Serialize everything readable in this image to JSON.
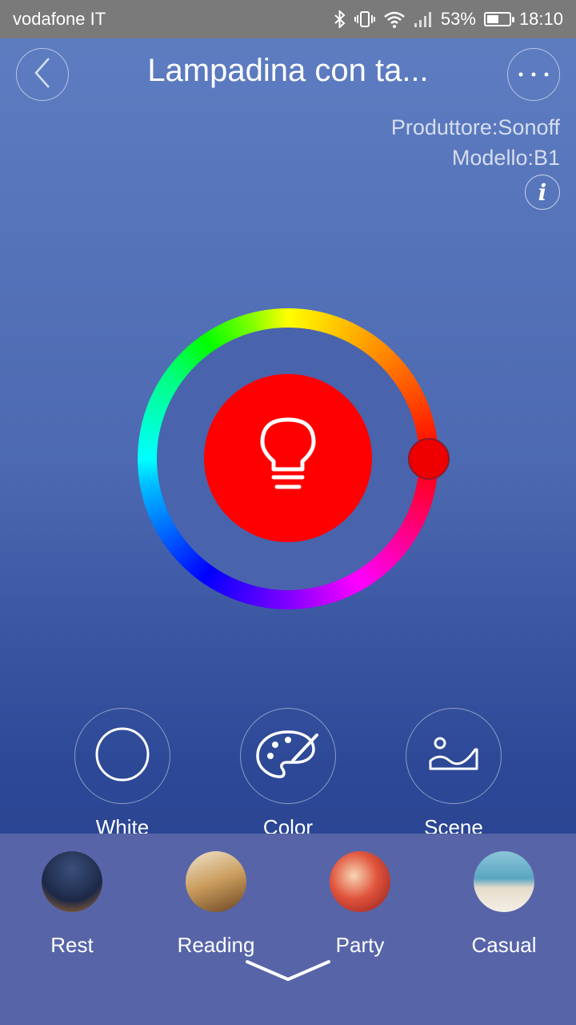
{
  "status_bar": {
    "carrier": "vodafone IT",
    "battery_percent": "53%",
    "battery_level": 0.53,
    "time": "18:10"
  },
  "header": {
    "title": "Lampadina con ta...",
    "back_icon": "chevron-left-icon",
    "more_icon": "more-dots-icon"
  },
  "device": {
    "manufacturer": "Produttore:Sonoff",
    "model": "Modello:B1",
    "info_icon": "i"
  },
  "color_wheel": {
    "selected_color": "#ff0000",
    "bulb_icon": "lightbulb-icon"
  },
  "modes": [
    {
      "label": "White",
      "icon": "circle-icon"
    },
    {
      "label": "Color",
      "icon": "palette-icon"
    },
    {
      "label": "Scene",
      "icon": "landscape-icon"
    }
  ],
  "scenes": [
    {
      "label": "Rest"
    },
    {
      "label": "Reading"
    },
    {
      "label": "Party"
    },
    {
      "label": "Casual"
    }
  ],
  "colors": {
    "status_bar_bg": "#7a7a7a",
    "background_top": "#5f7ec2",
    "background_bottom": "#263f8c",
    "scene_panel_bg": "#5765a8",
    "bulb_color": "#ff0000"
  }
}
